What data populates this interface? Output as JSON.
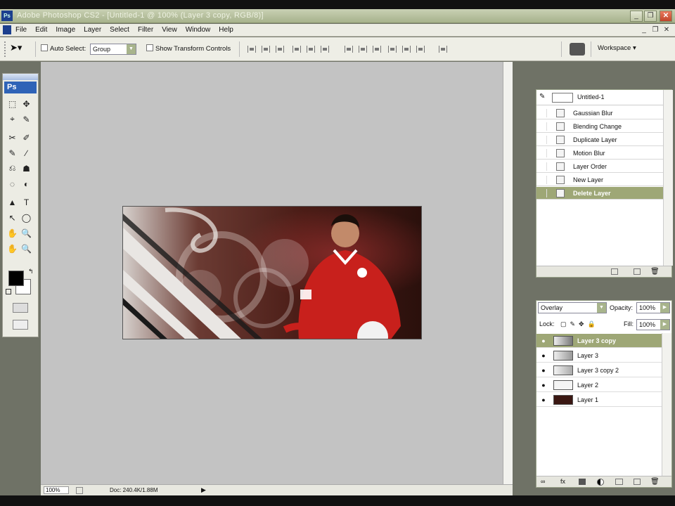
{
  "window": {
    "app_icon": "Ps",
    "title": "Adobe Photoshop CS2 - [Untitled-1 @ 100% (Layer 3 copy, RGB/8)]",
    "minimize": "_",
    "restore": "❐",
    "close": "✕"
  },
  "menubar": {
    "items": [
      "File",
      "Edit",
      "Image",
      "Layer",
      "Select",
      "Filter",
      "View",
      "Window",
      "Help"
    ]
  },
  "options": {
    "auto_select_label": "Auto Select:",
    "auto_select_value": "Group",
    "show_transform_label": "Show Transform Controls",
    "workspace_label": "Workspace ▾"
  },
  "toolbox": {
    "logo": "Ps",
    "tools": [
      "⬚",
      "✥",
      "⌖",
      "✎",
      "✂",
      "✐",
      "✎",
      "∕",
      "⎌",
      "☗",
      "◌",
      "◐",
      "▲",
      "T",
      "↖",
      "◯",
      "✋",
      "🔍",
      "✋",
      "🔍"
    ]
  },
  "history": {
    "snapshot": "Untitled-1",
    "items": [
      "Gaussian Blur",
      "Blending Change",
      "Duplicate Layer",
      "Motion Blur",
      "Layer Order",
      "New Layer",
      "Delete Layer"
    ],
    "selected_index": 6
  },
  "layers": {
    "blend_mode": "Overlay",
    "opacity_label": "Opacity:",
    "opacity_value": "100%",
    "lock_label": "Lock:",
    "fill_label": "Fill:",
    "fill_value": "100%",
    "items": [
      "Layer 3 copy",
      "Layer 3",
      "Layer 3 copy 2",
      "Layer 2",
      "Layer 1"
    ],
    "selected_index": 0
  },
  "status": {
    "zoom": "100%",
    "doc": "Doc: 240.4K/1.88M"
  },
  "colors": {
    "selection": "#9ea776",
    "titlebar": "#b3bd98",
    "workspace": "#c3c3c3",
    "foreground": "#000000",
    "background": "#ffffff"
  }
}
